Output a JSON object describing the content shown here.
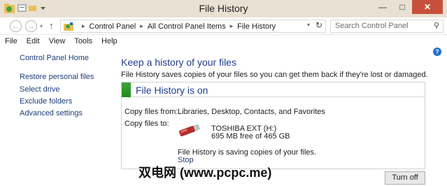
{
  "window": {
    "title": "File History",
    "minimize_glyph": "—",
    "maximize_glyph": "□",
    "close_glyph": "✕"
  },
  "nav": {
    "back_glyph": "←",
    "forward_glyph": "→",
    "history_glyph": "▾",
    "up_glyph": "↑"
  },
  "address": {
    "separator": "▸",
    "crumbs": [
      "Control Panel",
      "All Control Panel Items",
      "File History"
    ],
    "dropdown_glyph": "▾",
    "refresh_glyph": "↻"
  },
  "search": {
    "placeholder": "Search Control Panel",
    "icon_glyph": "⚲"
  },
  "menu": [
    "File",
    "Edit",
    "View",
    "Tools",
    "Help"
  ],
  "left_nav": {
    "home": "Control Panel Home",
    "links": [
      "Restore personal files",
      "Select drive",
      "Exclude folders",
      "Advanced settings"
    ]
  },
  "help_glyph": "?",
  "main": {
    "heading": "Keep a history of your files",
    "description": "File History saves copies of your files so you can get them back if they're lost or damaged.",
    "status": "File History is on",
    "copy_from_label": "Copy files from:",
    "copy_from_value": "Libraries, Desktop, Contacts, and Favorites",
    "copy_to_label": "Copy files to:",
    "drive_name": "TOSHIBA EXT (H:)",
    "drive_free": "695 MB free of 465 GB",
    "saving_message": "File History is saving copies of your files.",
    "stop_link": "Stop",
    "turn_off_button": "Turn off"
  },
  "watermark": "双电网 (www.pcpc.me)",
  "colors": {
    "title_bar": "#e9e1d3",
    "link": "#1b3e78",
    "heading": "#1e3d8f",
    "status_on": "#3fa43a",
    "close_button": "#c7503c"
  }
}
